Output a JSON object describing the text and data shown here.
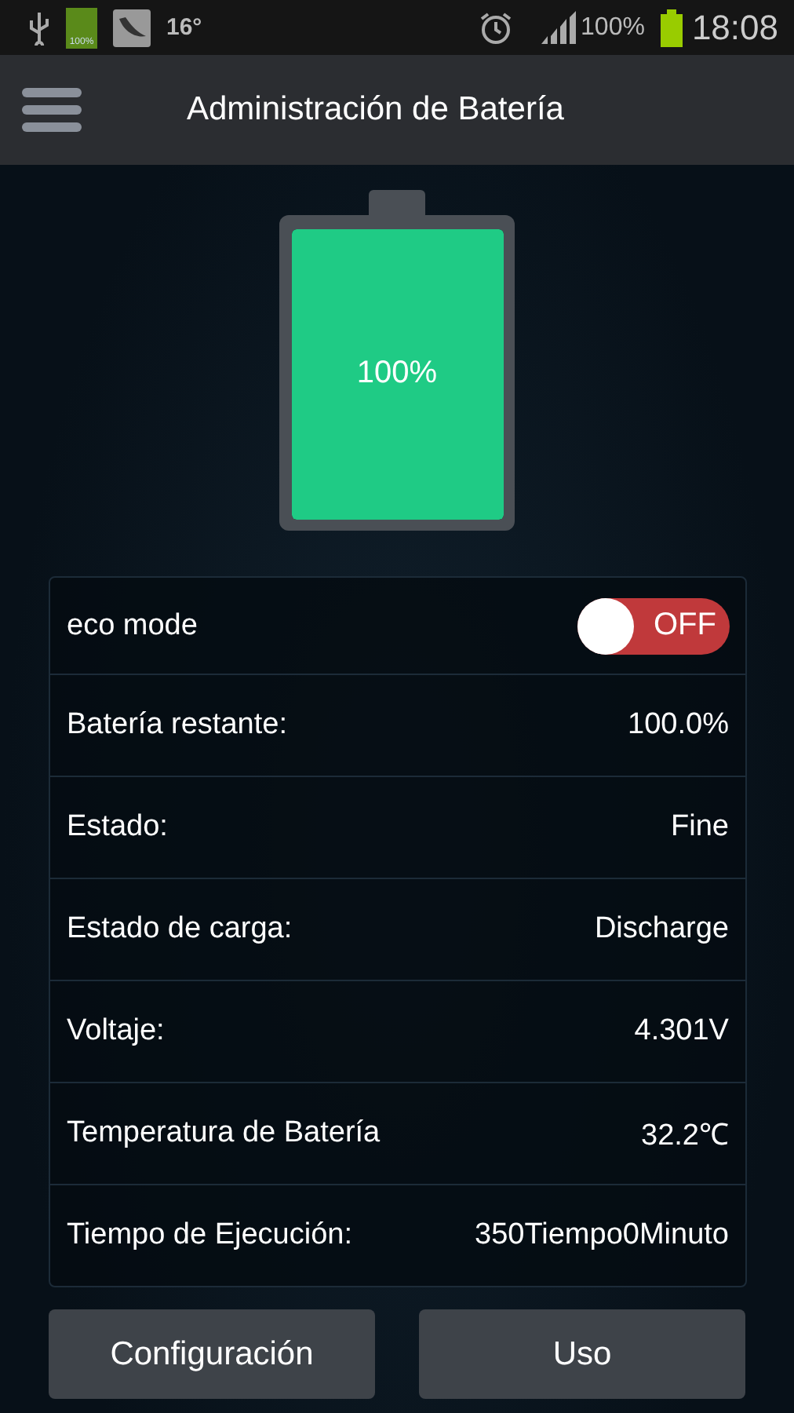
{
  "status_bar": {
    "battery_small_label": "100%",
    "temperature": "16°",
    "battery_percent": "100%",
    "time": "18:08"
  },
  "toolbar": {
    "title": "Administración de Batería"
  },
  "battery": {
    "label": "100%"
  },
  "rows": [
    {
      "kind": "toggle",
      "label": "eco mode",
      "on": false,
      "toggle_label": "OFF"
    },
    {
      "kind": "value",
      "label": "Batería restante:",
      "value": "100.0%"
    },
    {
      "kind": "value",
      "label": "Estado:",
      "value": "Fine"
    },
    {
      "kind": "value",
      "label": "Estado de carga:",
      "value": "Discharge"
    },
    {
      "kind": "value",
      "label": "Voltaje:",
      "value": "4.301V"
    },
    {
      "kind": "value",
      "label": "Temperatura de Batería",
      "value": "32.2℃"
    },
    {
      "kind": "value",
      "label": "Tiempo de Ejecución:",
      "value": "350Tiempo0Minuto"
    }
  ],
  "buttons": [
    "Configuración",
    "Uso"
  ]
}
